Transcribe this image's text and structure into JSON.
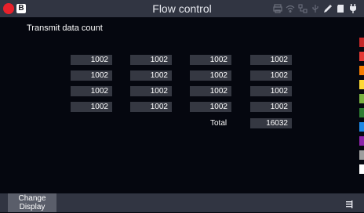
{
  "titlebar": {
    "title": "Flow control",
    "channel_badge": "B",
    "record_color": "#e8212b",
    "status_icons": [
      "printer-icon",
      "wifi-icon",
      "network-icon",
      "usb-icon",
      "pen-icon",
      "sd-card-icon",
      "power-plug-icon"
    ]
  },
  "main": {
    "section_title": "Transmit data count",
    "rows": [
      [
        "1002",
        "1002",
        "1002",
        "1002"
      ],
      [
        "1002",
        "1002",
        "1002",
        "1002"
      ],
      [
        "1002",
        "1002",
        "1002",
        "1002"
      ],
      [
        "1002",
        "1002",
        "1002",
        "1002"
      ]
    ],
    "total_label": "Total",
    "total_value": "16032"
  },
  "color_strip": [
    "#c62828",
    "#e53935",
    "#f57c00",
    "#fdd835",
    "#7cb342",
    "#2e7d32",
    "#1e88e5",
    "#8e24aa",
    "#9e9e9e",
    "#ffffff"
  ],
  "bottombar": {
    "change_display_label": "Change\nDisplay",
    "menu_icon": "menu-icon"
  }
}
